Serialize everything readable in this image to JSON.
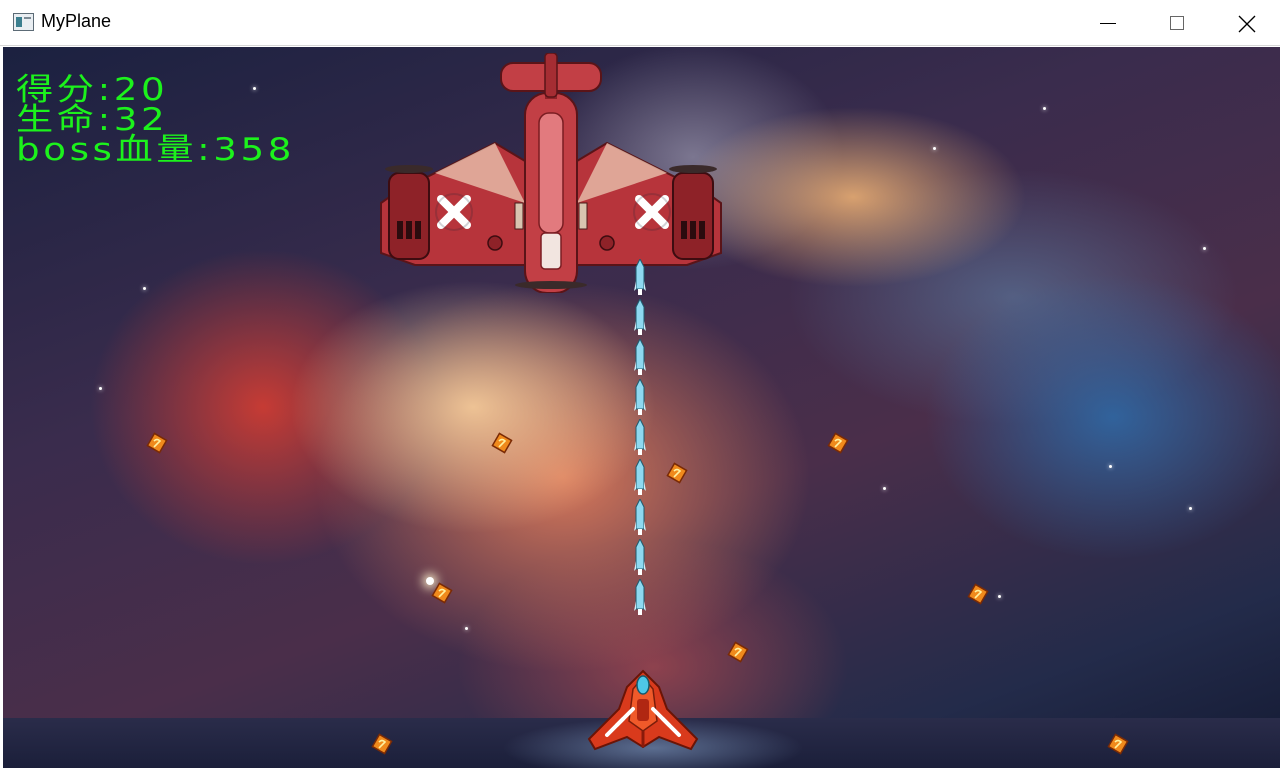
{
  "window": {
    "title": "MyPlane",
    "icons": {
      "app": "app-window-icon",
      "minimize": "minimize-icon",
      "maximize": "maximize-icon",
      "close": "close-icon"
    }
  },
  "hud": {
    "score_label": "得分:",
    "score_value": "20",
    "life_label": "生命:",
    "life_value": "32",
    "boss_label": "boss血量:",
    "boss_value": "358",
    "color": "#1cf21c"
  },
  "sprites": {
    "boss": "boss-plane",
    "player": "player-plane",
    "player_missile_count": 9,
    "enemy_bullet_count": 10
  },
  "colors": {
    "boss_body": "#b7343b",
    "player_body": "#d93a1c",
    "missile": "#8ed8f0",
    "enemy_bullet": "#f08a1c"
  }
}
